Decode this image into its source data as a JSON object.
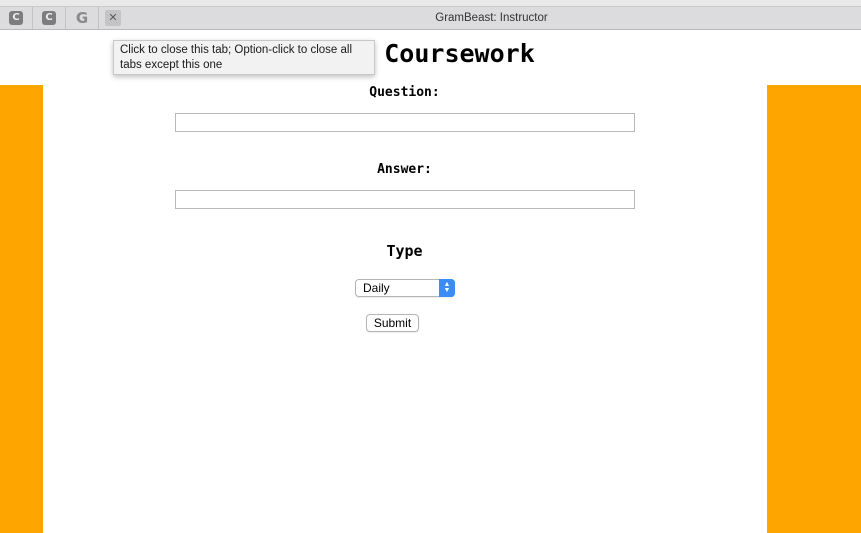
{
  "tabbar": {
    "pinned_tabs": [
      {
        "glyph": "C",
        "icon": "c-favicon-icon"
      },
      {
        "glyph": "C",
        "icon": "c-favicon-icon"
      },
      {
        "glyph": "G",
        "icon": "google-favicon-icon"
      }
    ],
    "close_glyph": "✕",
    "active_title": "GramBeast: Instructor"
  },
  "tooltip": {
    "text": "Click to close this tab; Option-click to close all tabs except this one"
  },
  "page": {
    "title": "Coursework",
    "question_label": "Question:",
    "question_value": "",
    "answer_label": "Answer:",
    "answer_value": "",
    "type_label": "Type",
    "type_selected": "Daily",
    "submit_label": "Submit"
  },
  "colors": {
    "side_bar": "#ffa500",
    "select_arrow": "#3b8df5"
  }
}
